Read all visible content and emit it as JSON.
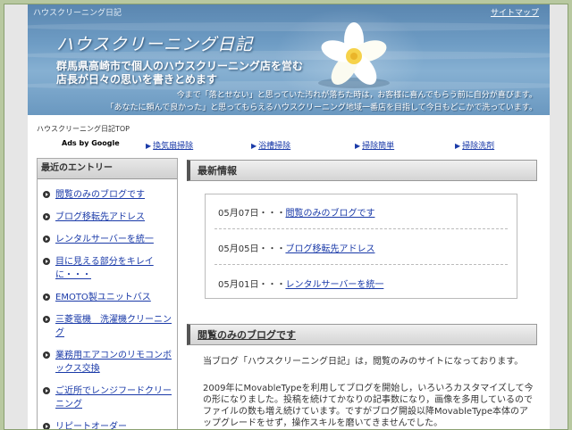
{
  "header": {
    "site_small": "ハウスクリーニング日記",
    "sitemap": "サイトマップ",
    "title": "ハウスクリーニング日記",
    "tagline_1": "群馬県高崎市で個人のハウスクリーニング店を営む",
    "tagline_2": "店長が日々の思いを書きとめます",
    "desc_1": "今まで「落とせない」と思っていた汚れが落ちた時は，お客様に喜んでもらう前に自分が喜びます。",
    "desc_2": "「あなたに頼んで良かった」と思ってもらえるハウスクリーニング地域一番店を目指して今日もどこかで洗っています。"
  },
  "breadcrumb": "ハウスクリーニング日記TOP",
  "nav": {
    "ads": "Ads by Google",
    "links": [
      "換気扇掃除",
      "浴槽掃除",
      "掃除簡単",
      "掃除洗剤"
    ]
  },
  "sidebar": {
    "heading": "最近のエントリー",
    "entries": [
      "閲覧のみのブログです",
      "ブログ移転先アドレス",
      "レンタルサーバーを統一",
      "目に見える部分をキレイに・・・",
      "EMOTO製ユニットバス",
      "三菱電機　洗濯機クリーニング",
      "業務用エアコンのリモコンボックス交換",
      "ご近所でレンジフードクリーニング",
      "リピートオーダー"
    ]
  },
  "news": {
    "heading": "最新情報",
    "items": [
      {
        "date": "05月07日・・・",
        "title": "閲覧のみのブログです"
      },
      {
        "date": "05月05日・・・",
        "title": "ブログ移転先アドレス"
      },
      {
        "date": "05月01日・・・",
        "title": "レンタルサーバーを統一"
      }
    ]
  },
  "article": {
    "heading": "閲覧のみのブログです",
    "para_1": "当ブログ「ハウスクリーニング日記」は，閲覧のみのサイトになっております。",
    "para_2": "2009年にMovableTypeを利用してブログを開始し，いろいろカスタマイズして今の形になりました。投稿を続けてかなりの記事数になり，画像を多用しているのでファイルの数も増え続けています。ですがブログ開設以降MovableType本体のアップグレードをせず，操作スキルを磨いてきませんでした。"
  }
}
